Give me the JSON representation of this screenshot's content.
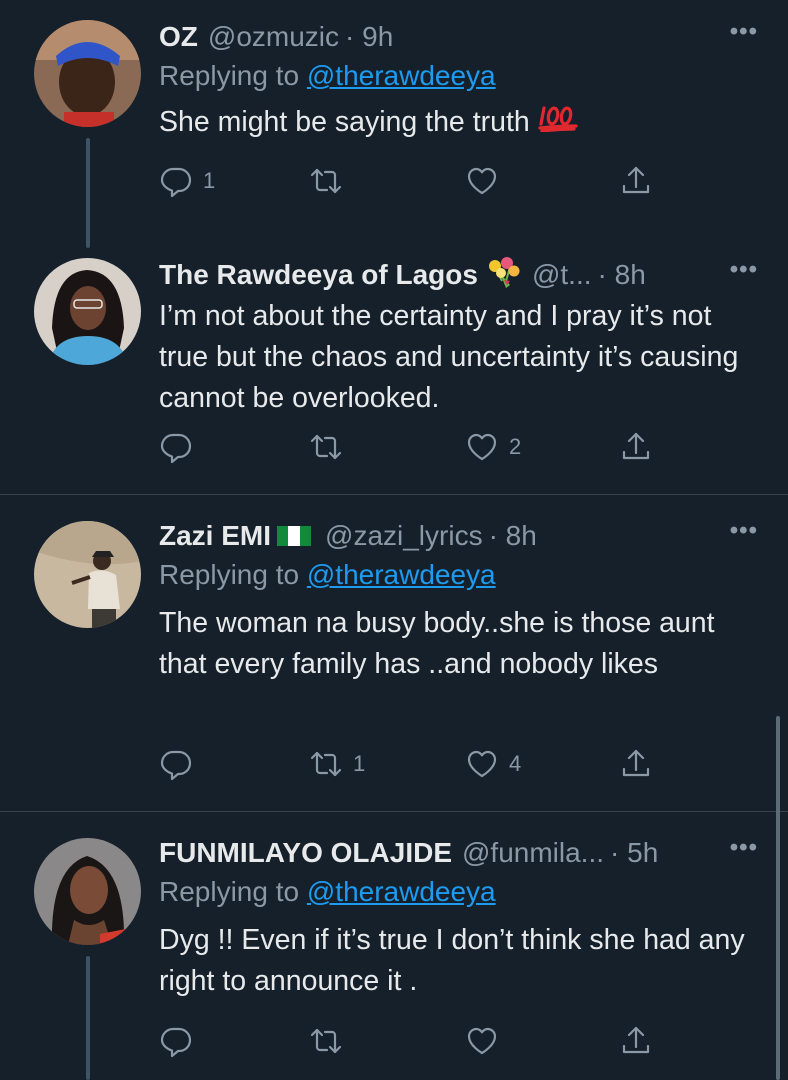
{
  "tweets": [
    {
      "name": "OZ",
      "handle": "@ozmuzic",
      "time": "· 9h",
      "replying_label": "Replying to ",
      "replying_to": "@therawdeeya",
      "text": "She might be saying the truth",
      "emoji": "100-icon",
      "replies": "1",
      "retweets": "",
      "likes": ""
    },
    {
      "name": "The Rawdeeya of Lagos",
      "handle": "@t...",
      "time": "· 8h",
      "emoji": "bouquet-icon",
      "text": "I’m not about the certainty and I pray it’s not true but the chaos and uncertainty it’s causing cannot be overlooked.",
      "replies": "",
      "retweets": "",
      "likes": "2"
    },
    {
      "name": "Zazi EMI",
      "handle": "@zazi_lyrics",
      "time": "· 8h",
      "emoji": "nigeria-flag-icon",
      "replying_label": "Replying to ",
      "replying_to": "@therawdeeya",
      "text": "The woman na busy body..she is those aunt that every family has ..and nobody likes",
      "replies": "",
      "retweets": "1",
      "likes": "4"
    },
    {
      "name": "FUNMILAYO OLAJIDE",
      "handle": "@funmila...",
      "time": "· 5h",
      "replying_label": "Replying to ",
      "replying_to": "@therawdeeya",
      "text": "Dyg !! Even if it’s true I don’t think she had any right to announce it .",
      "replies": "",
      "retweets": "",
      "likes": ""
    }
  ],
  "more_label": "•••",
  "colors": {
    "background": "#15202b",
    "text": "#e7e9ea",
    "secondary": "#8b98a5",
    "link": "#1d9bf0",
    "divider": "#38444d"
  }
}
